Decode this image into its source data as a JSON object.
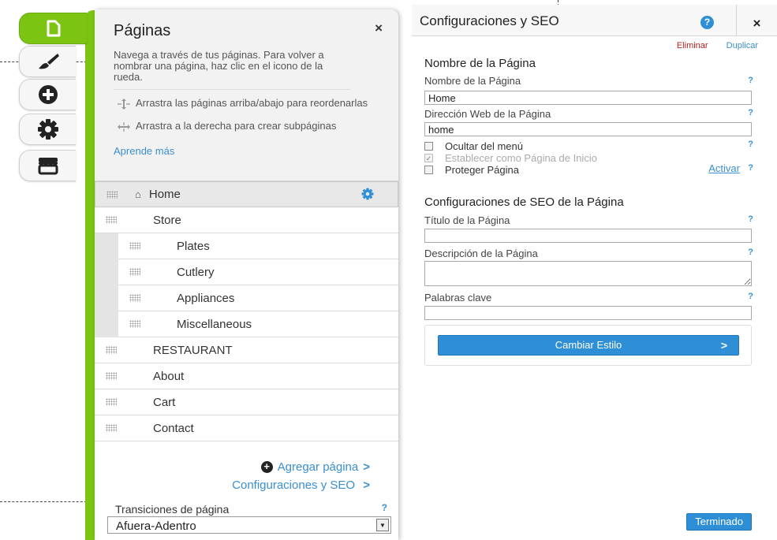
{
  "toolbar": {
    "tools": [
      {
        "name": "pages",
        "icon": "page-icon",
        "active": true
      },
      {
        "name": "design",
        "icon": "paintbrush-icon"
      },
      {
        "name": "add",
        "icon": "plus-circle-icon"
      },
      {
        "name": "settings",
        "icon": "gear-icon"
      },
      {
        "name": "store",
        "icon": "store-icon"
      }
    ]
  },
  "pages_panel": {
    "title": "Páginas",
    "close": "×",
    "description": "Navega a través de tus páginas. Para volver a nombrar una página, haz clic en el icono de la rueda.",
    "hints": [
      {
        "icon": "drag-vertical-icon",
        "text": "Arrastra las páginas arriba/abajo para reordenarlas"
      },
      {
        "icon": "drag-horizontal-icon",
        "text": "Arrastra a la derecha para crear subpáginas"
      }
    ],
    "learn_more": "Aprende más",
    "pages": [
      {
        "label": "Home",
        "level": 0,
        "selected": true,
        "home": true
      },
      {
        "label": "Store",
        "level": 0
      },
      {
        "label": "Plates",
        "level": 1
      },
      {
        "label": "Cutlery",
        "level": 1
      },
      {
        "label": "Appliances",
        "level": 1
      },
      {
        "label": "Miscellaneous",
        "level": 1
      },
      {
        "label": "RESTAURANT",
        "level": 0
      },
      {
        "label": "About",
        "level": 0
      },
      {
        "label": "Cart",
        "level": 0
      },
      {
        "label": "Contact",
        "level": 0
      }
    ],
    "add_page": "Agregar página",
    "seo_link": "Configuraciones y SEO",
    "chevron": ">",
    "transitions_label": "Transiciones de página",
    "transitions_help": "?",
    "transitions_value": "Afuera-Adentro"
  },
  "settings": {
    "title": "Configuraciones y SEO",
    "help": "?",
    "close": "×",
    "delete": "Eliminar",
    "duplicate": "Duplicar",
    "section_name": "Nombre de la Página",
    "page_name_label": "Nombre de la Página",
    "page_name_value": "Home",
    "web_address_label": "Dirección Web de la Página",
    "web_address_value": "home",
    "hide_menu": "Ocultar del menú",
    "set_home": "Establecer como Página de Inicio",
    "set_home_checked": true,
    "protect": "Proteger Página",
    "activate": "Activar",
    "section_seo": "Configuraciones de SEO de la Página",
    "seo_title_label": "Título de la Página",
    "seo_title_value": "",
    "description_label": "Descripción de la Página",
    "description_value": "",
    "keywords_label": "Palabras clave",
    "keywords_value": "",
    "change_style": "Cambiar Estilo",
    "change_style_arrow": ">",
    "done": "Terminado",
    "q": "?"
  },
  "colors": {
    "accent_green": "#7cc412",
    "link_blue": "#3a8fcf",
    "button_blue": "#2f8fd6",
    "delete_red": "#b22222"
  }
}
